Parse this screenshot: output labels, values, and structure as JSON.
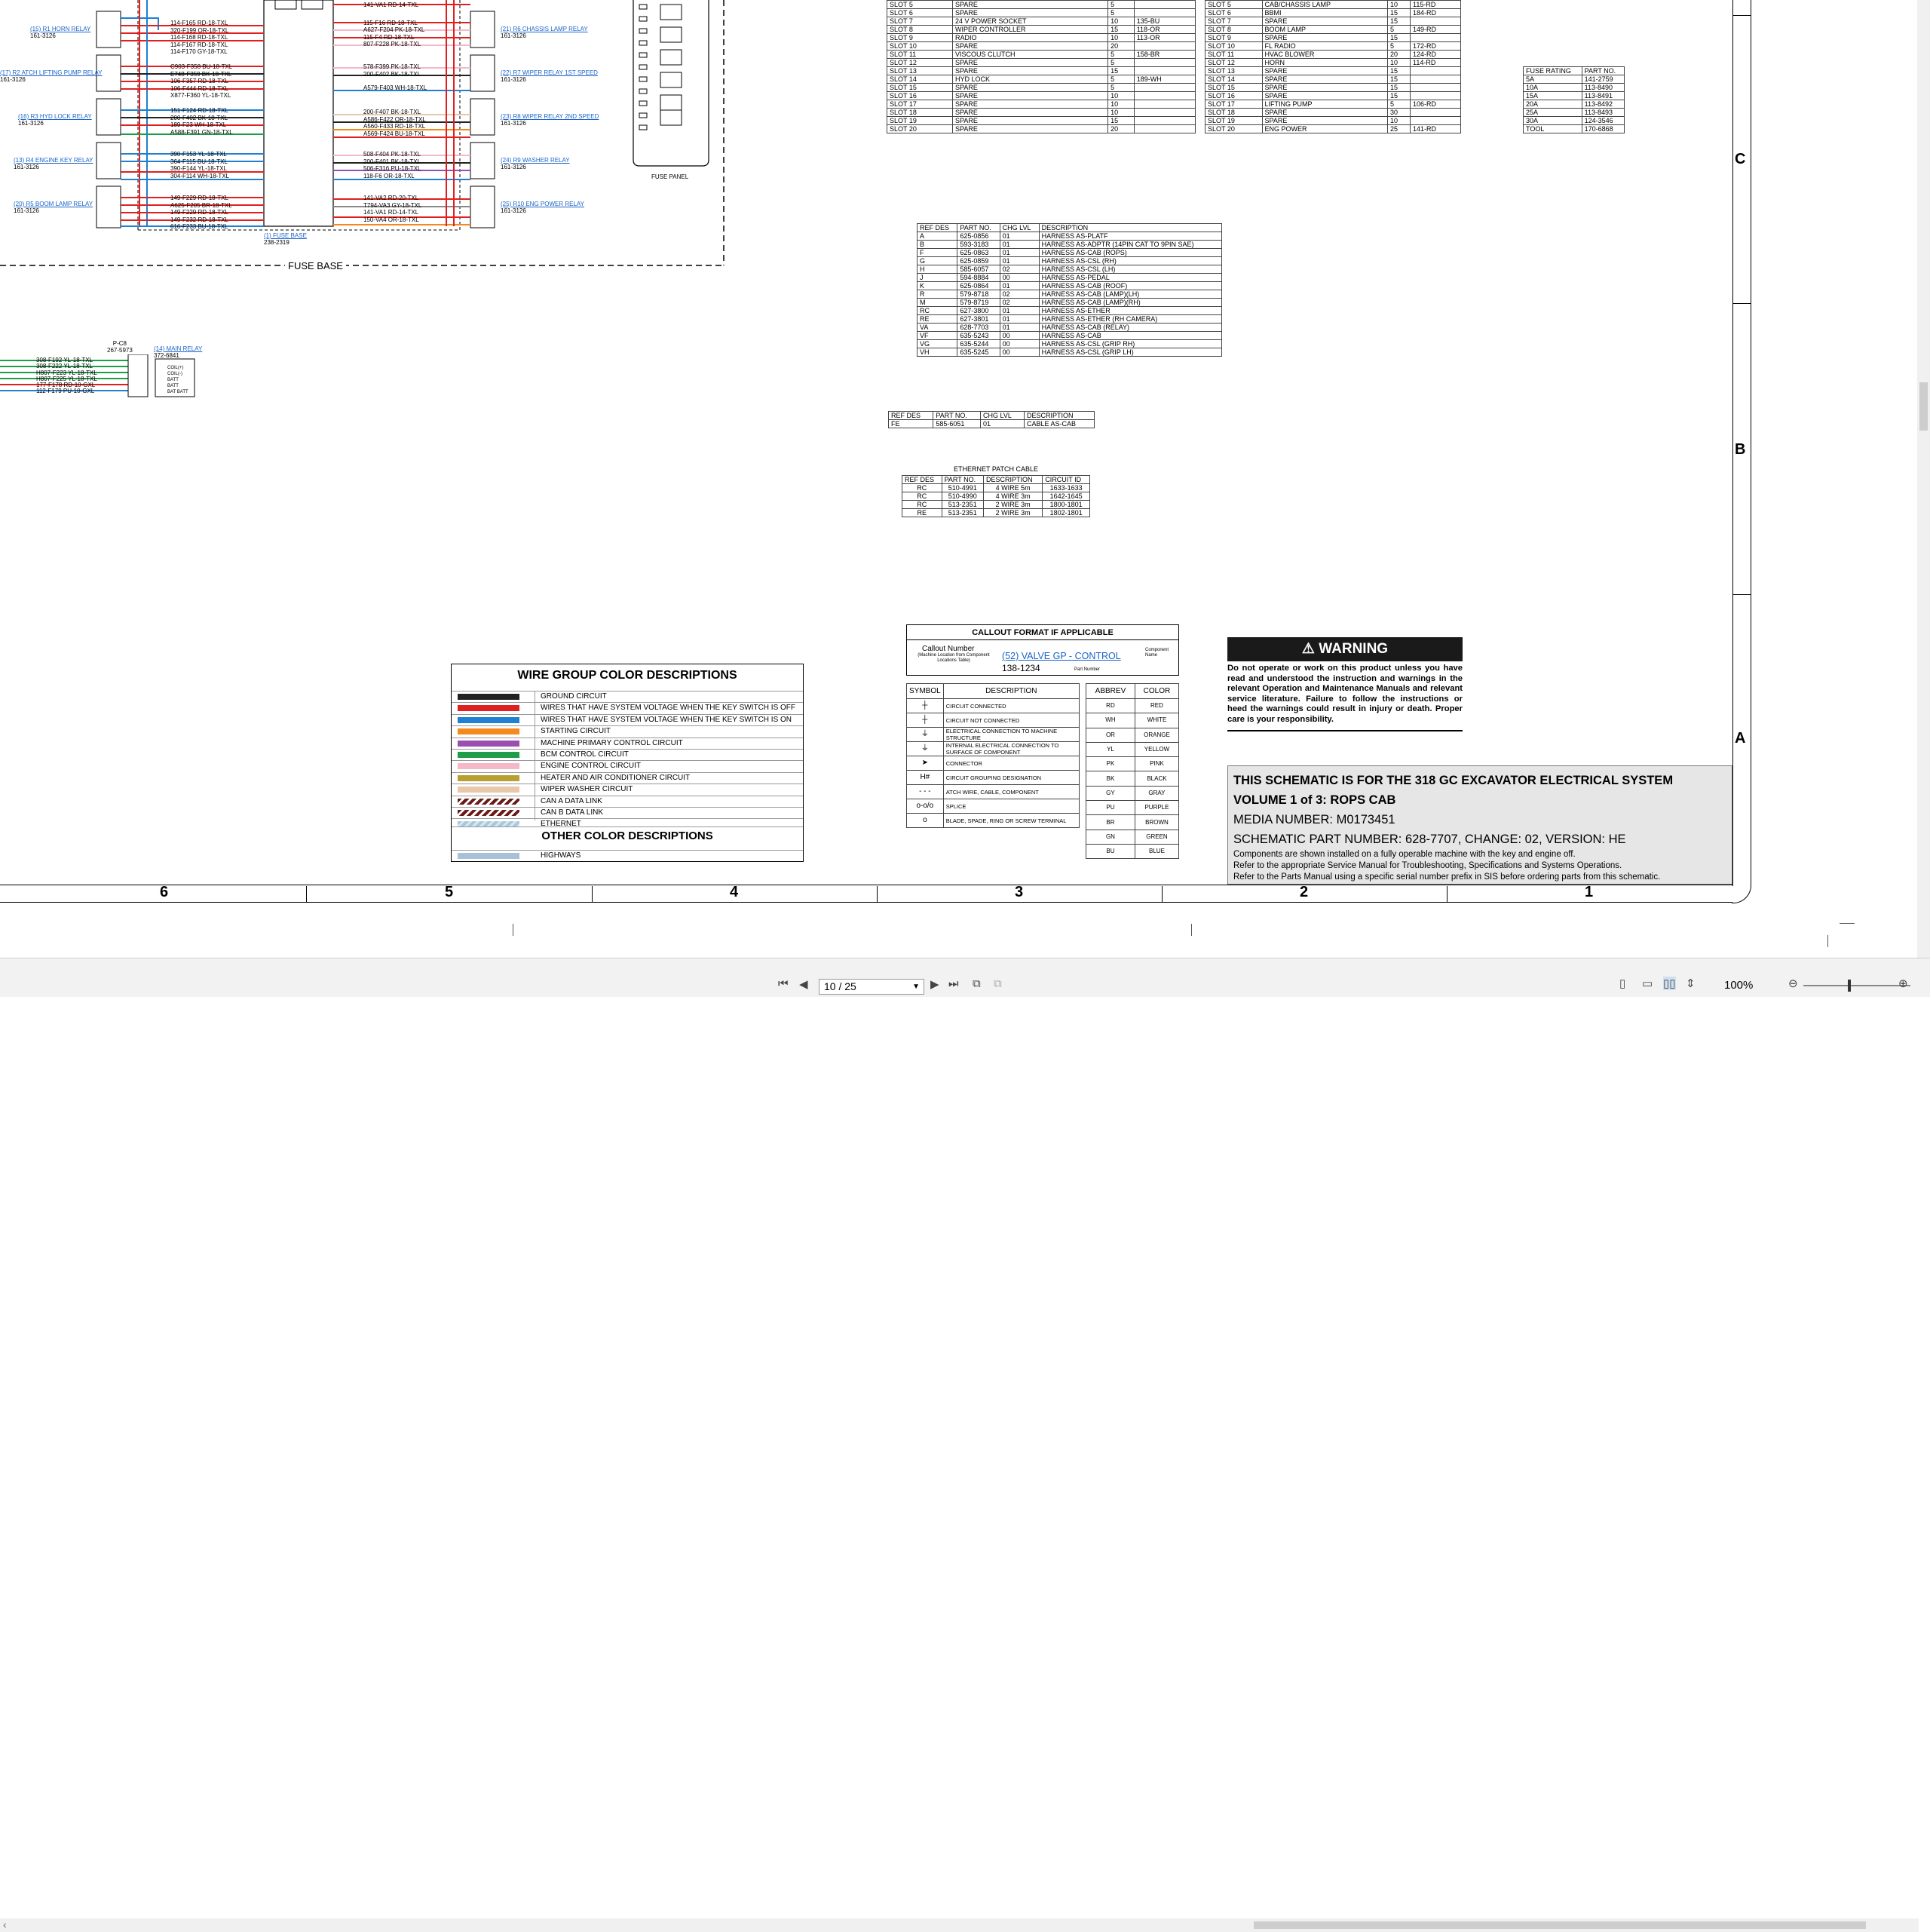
{
  "schematic": {
    "fuse_base_label": "FUSE BASE",
    "fuse_panel_label": "FUSE PANEL",
    "relays_left": [
      {
        "name": "(15) R1 HORN RELAY",
        "part": "161-3126"
      },
      {
        "name": "(17) R2 ATCH LIFTING PUMP RELAY",
        "part": "161-3126"
      },
      {
        "name": "(16) R3 HYD LOCK RELAY",
        "part": "161-3126"
      },
      {
        "name": "(13) R4 ENGINE KEY RELAY",
        "part": "161-3126"
      },
      {
        "name": "(20) R5 BOOM LAMP RELAY",
        "part": "161-3126"
      }
    ],
    "relays_right": [
      {
        "name": "(21) R6 CHASSIS LAMP RELAY",
        "part": "161-3126"
      },
      {
        "name": "(22) R7 WIPER RELAY 1ST SPEED",
        "part": "161-3126"
      },
      {
        "name": "(23) R8 WIPER RELAY 2ND SPEED",
        "part": "161-3126"
      },
      {
        "name": "(24) R9 WASHER RELAY",
        "part": "161-3126"
      },
      {
        "name": "(25) R10 ENG POWER RELAY",
        "part": "161-3126"
      }
    ],
    "wires_left": [
      [
        "114-F165 RD-18-TXL",
        "320-F199 OR-18-TXL",
        "114-F168 RD-18-TXL",
        "114-F167 RD-18-TXL",
        "114-F170 GY-18-TXL"
      ],
      [
        "C903-F358 BU-18-TXL",
        "E748-F359 BK-18-TXL",
        "106-F357 RD-18-TXL",
        "106-F444 RD-18-TXL",
        "X877-F360 YL-18-TXL"
      ],
      [
        "151-F124 RD-18-TXL",
        "200-F402 BK-18-TXL",
        "189-F23 WH-18-TXL",
        "",
        "A588-F391 GN-18-TXL"
      ],
      [
        "390-F153 YL-18-TXL",
        "364-F115 BU-18-TXL",
        "",
        "390-F144 YL-18-TXL",
        "304-F114 WH-18-TXL"
      ],
      [
        "149-F229 RD-18-TXL",
        "A625-F205 BR-18-TXL",
        "149-F229 RD-18-TXL",
        "149-F232 RD-18-TXL",
        "616-F233 BU-18-TXL"
      ]
    ],
    "wires_right": [
      [
        "141-VA1 RD-14-TXL",
        "115-F16 RD-18-TXL",
        "A627-F204 PK-18-TXL",
        "115-F4 RD-18-TXL",
        "807-F228 PK-18-TXL"
      ],
      [
        "578-F399 PK-18-TXL",
        "200-F402 BK-18-TXL"
      ],
      [
        "A579-F403 WH-18-TXL",
        "200-F407 BK-18-TXL",
        "A586-F422 OR-18-TXL",
        "A560-F433 RD-18-TXL",
        "A569-F424 BU-18-TXL"
      ],
      [
        "508-F404 PK-18-TXL",
        "200-F401 BK-18-TXL",
        "506-F316 PU-18-TXL",
        "",
        "118-F6 OR-18-TXL"
      ],
      [
        "141-VA2 RD-20-TXL",
        "T794-VA3 GY-18-TXL",
        "",
        "141-VA1 RD-14-TXL",
        "150-VA4 OR-18-TXL"
      ]
    ],
    "fuse_base_callout": {
      "name": "(1) FUSE BASE",
      "part": "238-2319"
    },
    "bottom_wires": [
      "308-F192 YL-18-TXL",
      "308-F222 YL-18-TXL",
      "H807-F223 YL-18-TXL",
      "H807-F225 YL-18-TXL",
      "177-F178 RD-10-GXL",
      "112-F179 PU-10-GXL"
    ],
    "bottom_relay": {
      "name": "(14) MAIN RELAY",
      "part": "372-6841",
      "connector": "P-C8",
      "connector_part": "267-5973",
      "pins": [
        "COIL(+)",
        "COIL(-)",
        "BATT",
        "BATT",
        "BAT BATT"
      ]
    }
  },
  "slot_table_left": [
    [
      "SLOT 5",
      "SPARE",
      "5",
      ""
    ],
    [
      "SLOT 6",
      "SPARE",
      "5",
      ""
    ],
    [
      "SLOT 7",
      "24 V POWER SOCKET",
      "10",
      "135-BU"
    ],
    [
      "SLOT 8",
      "WIPER CONTROLLER",
      "15",
      "118-OR"
    ],
    [
      "SLOT 9",
      "RADIO",
      "10",
      "113-OR"
    ],
    [
      "SLOT 10",
      "SPARE",
      "20",
      ""
    ],
    [
      "SLOT 11",
      "VISCOUS CLUTCH",
      "5",
      "158-BR"
    ],
    [
      "SLOT 12",
      "SPARE",
      "5",
      ""
    ],
    [
      "SLOT 13",
      "SPARE",
      "15",
      ""
    ],
    [
      "SLOT 14",
      "HYD LOCK",
      "5",
      "189-WH"
    ],
    [
      "SLOT 15",
      "SPARE",
      "5",
      ""
    ],
    [
      "SLOT 16",
      "SPARE",
      "10",
      ""
    ],
    [
      "SLOT 17",
      "SPARE",
      "10",
      ""
    ],
    [
      "SLOT 18",
      "SPARE",
      "10",
      ""
    ],
    [
      "SLOT 19",
      "SPARE",
      "15",
      ""
    ],
    [
      "SLOT 20",
      "SPARE",
      "20",
      ""
    ]
  ],
  "slot_table_right": [
    [
      "SLOT 5",
      "CAB/CHASSIS LAMP",
      "10",
      "115-RD"
    ],
    [
      "SLOT 6",
      "BBMI",
      "15",
      "184-RD"
    ],
    [
      "SLOT 7",
      "SPARE",
      "15",
      ""
    ],
    [
      "SLOT 8",
      "BOOM LAMP",
      "5",
      "149-RD"
    ],
    [
      "SLOT 9",
      "SPARE",
      "15",
      ""
    ],
    [
      "SLOT 10",
      "FL RADIO",
      "5",
      "172-RD"
    ],
    [
      "SLOT 11",
      "HVAC BLOWER",
      "20",
      "124-RD"
    ],
    [
      "SLOT 12",
      "HORN",
      "10",
      "114-RD"
    ],
    [
      "SLOT 13",
      "SPARE",
      "15",
      ""
    ],
    [
      "SLOT 14",
      "SPARE",
      "15",
      ""
    ],
    [
      "SLOT 15",
      "SPARE",
      "15",
      ""
    ],
    [
      "SLOT 16",
      "SPARE",
      "15",
      ""
    ],
    [
      "SLOT 17",
      "LIFTING PUMP",
      "5",
      "106-RD"
    ],
    [
      "SLOT 18",
      "SPARE",
      "30",
      ""
    ],
    [
      "SLOT 19",
      "SPARE",
      "10",
      ""
    ],
    [
      "SLOT 20",
      "ENG POWER",
      "25",
      "141-RD"
    ]
  ],
  "fuse_rating_table": {
    "headers": [
      "FUSE RATING",
      "PART NO."
    ],
    "rows": [
      [
        "5A",
        "141-2759"
      ],
      [
        "10A",
        "113-8490"
      ],
      [
        "15A",
        "113-8491"
      ],
      [
        "20A",
        "113-8492"
      ],
      [
        "25A",
        "113-8493"
      ],
      [
        "30A",
        "124-3546"
      ],
      [
        "TOOL",
        "170-6868"
      ]
    ]
  },
  "harness_table": {
    "headers": [
      "REF DES",
      "PART NO.",
      "CHG LVL",
      "DESCRIPTION"
    ],
    "rows": [
      [
        "A",
        "625-0856",
        "01",
        "HARNESS AS-PLATF"
      ],
      [
        "B",
        "593-3183",
        "01",
        "HARNESS AS-ADPTR (14PIN CAT TO 9PIN SAE)"
      ],
      [
        "F",
        "625-0863",
        "01",
        "HARNESS AS-CAB (ROPS)"
      ],
      [
        "G",
        "625-0859",
        "01",
        "HARNESS AS-CSL (RH)"
      ],
      [
        "H",
        "585-6057",
        "02",
        "HARNESS AS-CSL (LH)"
      ],
      [
        "J",
        "594-8884",
        "00",
        "HARNESS AS-PEDAL"
      ],
      [
        "K",
        "625-0864",
        "01",
        "HARNESS AS-CAB (ROOF)"
      ],
      [
        "R",
        "579-8718",
        "02",
        "HARNESS AS-CAB (LAMP)(LH)"
      ],
      [
        "M",
        "579-8719",
        "02",
        "HARNESS AS-CAB (LAMP)(RH)"
      ],
      [
        "RC",
        "627-3800",
        "01",
        "HARNESS AS-ETHER"
      ],
      [
        "RE",
        "627-3801",
        "01",
        "HARNESS AS-ETHER (RH CAMERA)"
      ],
      [
        "VA",
        "628-7703",
        "01",
        "HARNESS AS-CAB (RELAY)"
      ],
      [
        "VF",
        "635-5243",
        "00",
        "HARNESS AS-CAB"
      ],
      [
        "VG",
        "635-5244",
        "00",
        "HARNESS AS-CSL (GRIP RH)"
      ],
      [
        "VH",
        "635-5245",
        "00",
        "HARNESS AS-CSL (GRIP LH)"
      ]
    ]
  },
  "cable_table": {
    "headers": [
      "REF DES",
      "PART NO.",
      "CHG LVL",
      "DESCRIPTION"
    ],
    "rows": [
      [
        "FE",
        "585-6051",
        "01",
        "CABLE AS-CAB"
      ]
    ]
  },
  "ethernet_table": {
    "title": "ETHERNET PATCH CABLE",
    "headers": [
      "REF DES",
      "PART NO.",
      "DESCRIPTION",
      "CIRCUIT ID"
    ],
    "rows": [
      [
        "RC",
        "510-4991",
        "4 WIRE 5m",
        "1633-1633"
      ],
      [
        "RC",
        "510-4990",
        "4 WIRE 3m",
        "1642-1645"
      ],
      [
        "RC",
        "513-2351",
        "2 WIRE 3m",
        "1800-1801"
      ],
      [
        "RE",
        "513-2351",
        "2 WIRE 3m",
        "1802-1801"
      ]
    ]
  },
  "callout": {
    "title": "CALLOUT FORMAT IF APPLICABLE",
    "callout_number": "Callout Number",
    "callout_sub": "(Machine Location from Component Locations Table)",
    "example": "(52) VALVE GP - CONTROL",
    "example_part": "138-1234",
    "component_name": "Component Name",
    "part_number": "Part Number"
  },
  "symbol_table": {
    "headers": [
      "SYMBOL",
      "DESCRIPTION"
    ],
    "rows": [
      [
        "┼",
        "CIRCUIT CONNECTED"
      ],
      [
        "┼",
        "CIRCUIT NOT CONNECTED"
      ],
      [
        "⏚",
        "ELECTRICAL CONNECTION TO MACHINE STRUCTURE"
      ],
      [
        "⏚",
        "INTERNAL ELECTRICAL CONNECTION TO SURFACE OF COMPONENT"
      ],
      [
        "➤",
        "CONNECTOR"
      ],
      [
        "H#",
        "CIRCUIT GROUPING DESIGNATION"
      ],
      [
        "- - -",
        "ATCH WIRE, CABLE, COMPONENT"
      ],
      [
        "o-o/o",
        "SPLICE"
      ],
      [
        "o",
        "BLADE, SPADE, RING OR SCREW TERMINAL"
      ]
    ]
  },
  "abbrev_table": {
    "headers": [
      "ABBREV",
      "COLOR"
    ],
    "rows": [
      [
        "RD",
        "RED"
      ],
      [
        "WH",
        "WHITE"
      ],
      [
        "OR",
        "ORANGE"
      ],
      [
        "YL",
        "YELLOW"
      ],
      [
        "PK",
        "PINK"
      ],
      [
        "BK",
        "BLACK"
      ],
      [
        "GY",
        "GRAY"
      ],
      [
        "PU",
        "PURPLE"
      ],
      [
        "BR",
        "BROWN"
      ],
      [
        "GN",
        "GREEN"
      ],
      [
        "BU",
        "BLUE"
      ]
    ]
  },
  "wire_legend": {
    "title": "WIRE GROUP COLOR DESCRIPTIONS",
    "items": [
      {
        "label": "GROUND CIRCUIT",
        "color": "#222222"
      },
      {
        "label": "WIRES THAT HAVE SYSTEM VOLTAGE WHEN THE KEY SWITCH IS OFF",
        "color": "#e02020"
      },
      {
        "label": "WIRES THAT HAVE SYSTEM VOLTAGE WHEN THE KEY SWITCH IS ON",
        "color": "#1f7fd0"
      },
      {
        "label": "STARTING CIRCUIT",
        "color": "#f28a1e"
      },
      {
        "label": "MACHINE PRIMARY CONTROL CIRCUIT",
        "color": "#9a4fb0"
      },
      {
        "label": "BCM CONTROL CIRCUIT",
        "color": "#1f9e4a"
      },
      {
        "label": "ENGINE CONTROL CIRCUIT",
        "color": "#f4b8c8"
      },
      {
        "label": "HEATER AND AIR CONDITIONER CIRCUIT",
        "color": "#b8a030"
      },
      {
        "label": "WIPER WASHER CIRCUIT",
        "color": "#e8c8a8"
      },
      {
        "label": "CAN A DATA LINK",
        "color": "#6b1a1a"
      },
      {
        "label": "CAN B DATA LINK",
        "color": "#6b1a1a"
      },
      {
        "label": "ETHERNET",
        "color": "#a8c8e0"
      }
    ],
    "other_title": "OTHER COLOR DESCRIPTIONS",
    "other_items": [
      {
        "label": "HIGHWAYS",
        "color": "#a8c0d8"
      }
    ]
  },
  "warning": {
    "title": "WARNING",
    "text": "Do not operate or work on this product unless you have read and understood the instruction and warnings in the relevant Operation and Maintenance Manuals and relevant service literature. Failure to follow the instructions or heed the warnings could result in injury or death. Proper care is your responsibility."
  },
  "title_block": {
    "line1": "THIS SCHEMATIC IS FOR THE 318 GC EXCAVATOR ELECTRICAL SYSTEM",
    "line2": "VOLUME 1 of 3: ROPS CAB",
    "line3": "MEDIA NUMBER: M0173451",
    "line4": "SCHEMATIC PART NUMBER: 628-7707, CHANGE: 02, VERSION: HE",
    "line5": "Components are shown installed on a fully operable machine with the key and engine off.",
    "line6": "Refer to the appropriate Service Manual for Troubleshooting, Specifications and Systems Operations.",
    "line7": "Refer to the Parts Manual using a specific serial number prefix in SIS before ordering parts from this schematic."
  },
  "frame": {
    "columns": [
      "6",
      "5",
      "4",
      "3",
      "2",
      "1"
    ],
    "rows": [
      "C",
      "B",
      "A"
    ]
  },
  "viewer": {
    "page_indicator": "10 / 25",
    "zoom": "100%"
  }
}
